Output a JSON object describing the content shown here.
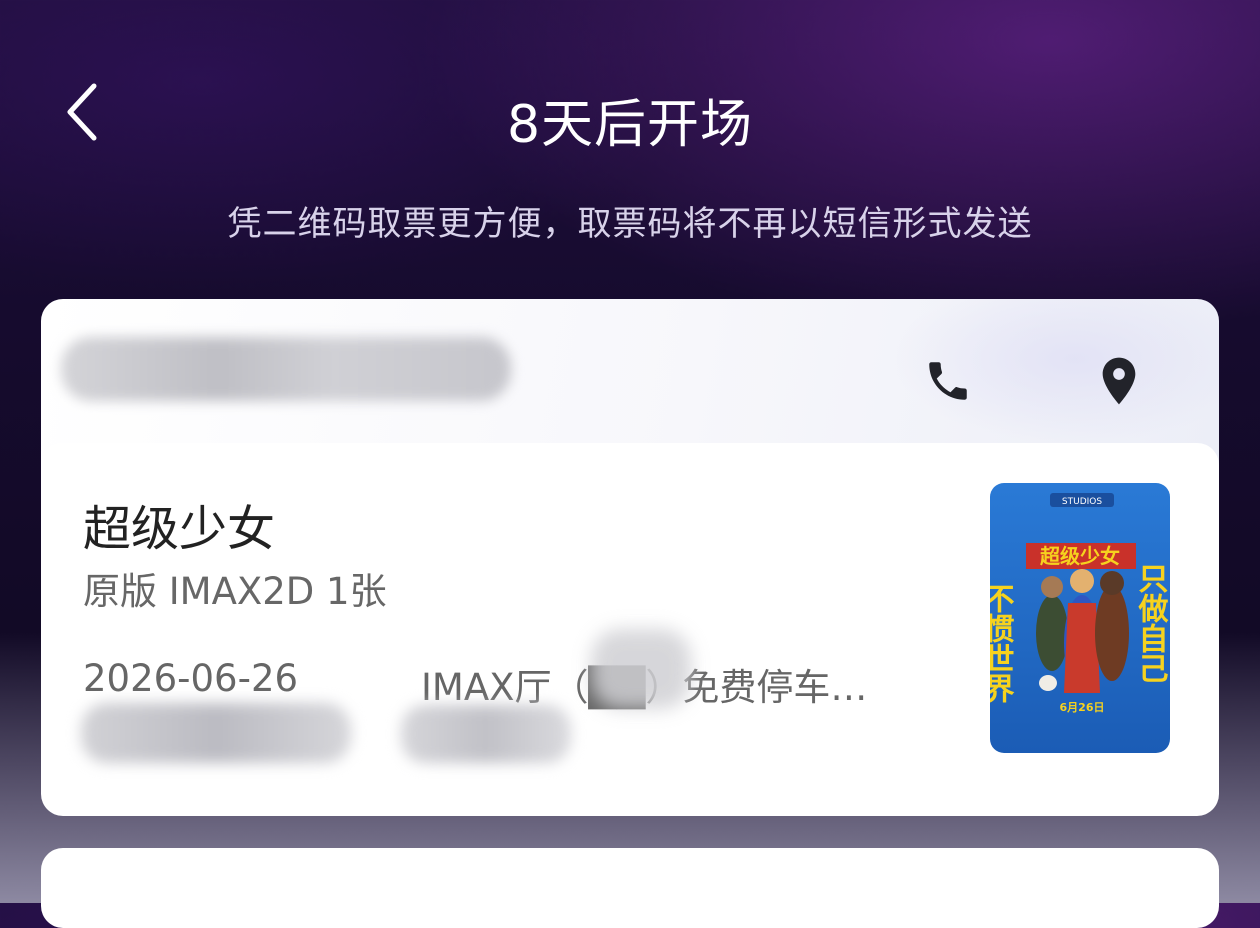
{
  "header": {
    "title": "8天后开场",
    "subtitle": "凭二维码取票更方便，取票码将不再以短信形式发送"
  },
  "cinema": {
    "name": "",
    "phone_icon": "phone-icon",
    "location_icon": "location-pin-icon"
  },
  "movie": {
    "title": "超级少女",
    "format": "原版 IMAX2D 1张",
    "date": "2026-06-26",
    "hall": "IMAX厅（██）免费停车…",
    "poster": {
      "studio": "STUDIOS",
      "title": "超级少女",
      "left_text": "不惯世界",
      "right_text": "只做自己",
      "release": "6月26日"
    }
  },
  "colors": {
    "background_top": "#1f0f3c",
    "card": "#ffffff",
    "poster_blue": "#1f6fd0",
    "poster_yellow": "#f6d21e"
  }
}
